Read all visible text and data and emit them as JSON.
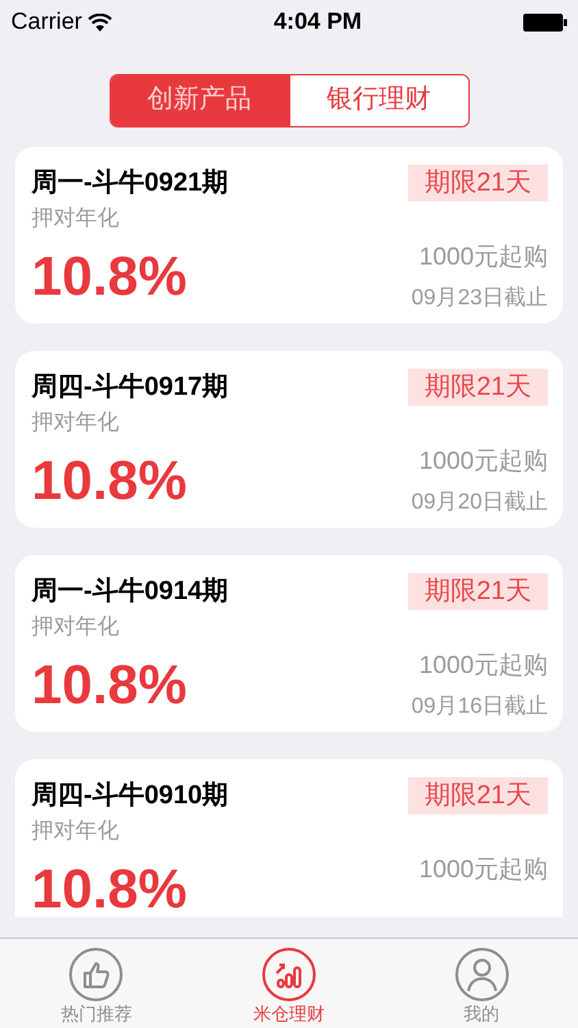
{
  "status_bar": {
    "carrier": "Carrier",
    "time": "4:04 PM"
  },
  "segments": [
    {
      "label": "创新产品",
      "selected": true
    },
    {
      "label": "银行理财",
      "selected": false
    }
  ],
  "products": [
    {
      "title": "周一-斗牛0921期",
      "subtitle": "押对年化",
      "rate": "10.8%",
      "term": "期限21天",
      "minimum": "1000元起购",
      "deadline": "09月23日截止"
    },
    {
      "title": "周四-斗牛0917期",
      "subtitle": "押对年化",
      "rate": "10.8%",
      "term": "期限21天",
      "minimum": "1000元起购",
      "deadline": "09月20日截止"
    },
    {
      "title": "周一-斗牛0914期",
      "subtitle": "押对年化",
      "rate": "10.8%",
      "term": "期限21天",
      "minimum": "1000元起购",
      "deadline": "09月16日截止"
    },
    {
      "title": "周四-斗牛0910期",
      "subtitle": "押对年化",
      "rate": "10.8%",
      "term": "期限21天",
      "minimum": "1000元起购"
    }
  ],
  "tab_bar": [
    {
      "kind": "thumbs",
      "label": "热门推荐",
      "selected": false
    },
    {
      "kind": "chart",
      "label": "米仓理财",
      "selected": true
    },
    {
      "kind": "person",
      "label": "我的",
      "selected": false
    }
  ]
}
